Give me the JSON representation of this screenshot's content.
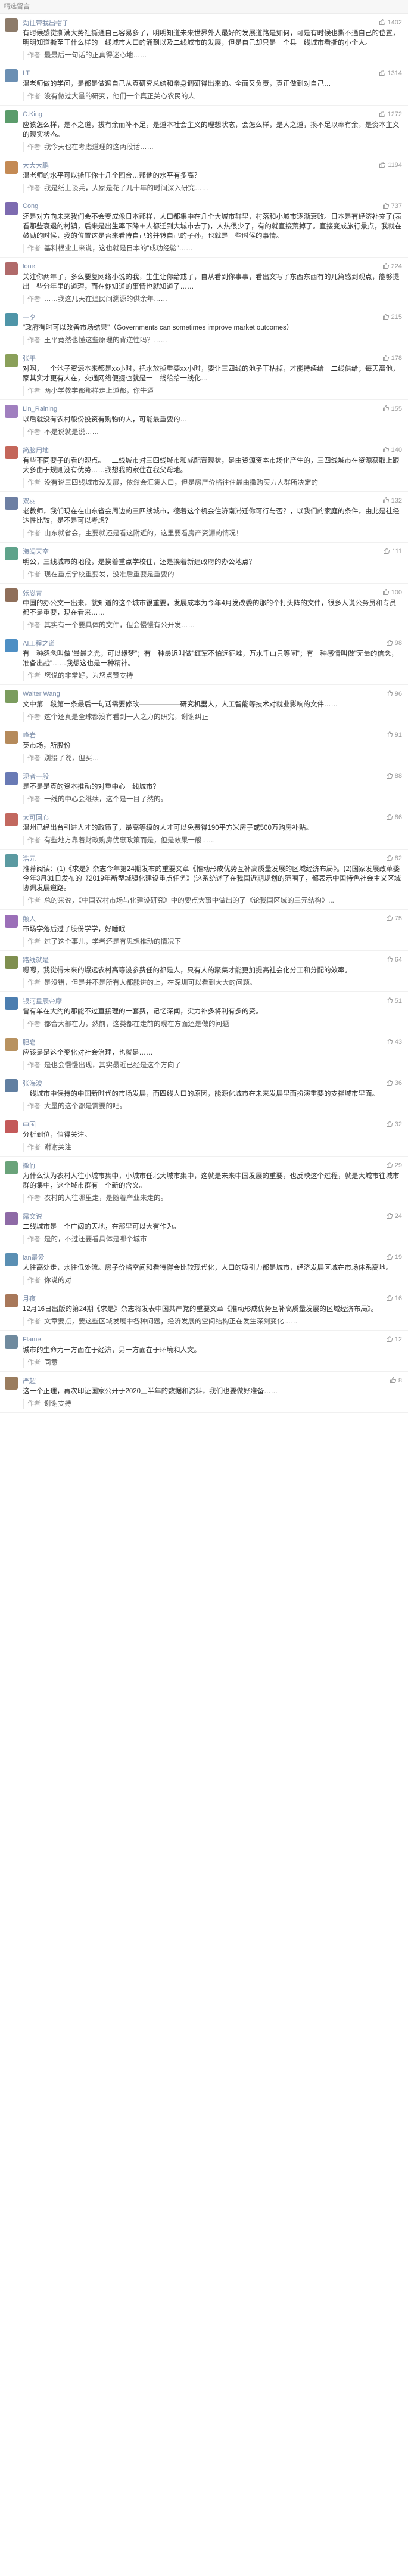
{
  "section_title": "精选留言",
  "author_label": "作者",
  "comments": [
    {
      "name": "劲往带我出帽子",
      "avatar_color": "#8d7b6a",
      "likes": "1402",
      "text": "有时候感觉撕满大势社撕通自己容易多了，明明知道未来世界外人最好的发展道路是如何，可是有时候也撕不通自己的位置，明明知道撕至于什么样的一线城市人口的涌到以及二线城市的发展，但是自己却只是一个县一线城市看撕的小个人。",
      "reply": "最最后一句话的正真得迷心地……"
    },
    {
      "name": "LT",
      "avatar_color": "#6b8fb3",
      "likes": "1314",
      "text": "温老师做的学问，是都是做遍自己从真研究总结和亲身调研得出来的。全面又负责，真正做到对自己…",
      "reply": "没有做过大量的研究，他们一个真正关心农民的人"
    },
    {
      "name": "C.King",
      "avatar_color": "#5b9c6b",
      "likes": "1272",
      "text": "应该怎么样，是不之道，拔有余而补不足，是道本社会主义的理想状态，会怎么样，是人之道，损不足以奉有余，是资本主义的现实状态。",
      "reply": "我今天也在考虑道理的这两段话……"
    },
    {
      "name": "大大大鹏",
      "avatar_color": "#c48a54",
      "likes": "1194",
      "text": "温老师的水平可以撕压你十几个回合…那他的水平有多高？",
      "reply": "我是纸上谈兵，人家是花了几十年的时间深入研究……"
    },
    {
      "name": "Cong",
      "avatar_color": "#7d6bb0",
      "likes": "737",
      "text": "还是对方向未来我们会不会变成像日本那样，人口都集中在几个大城市群里，村落和小城市逐渐衰败。日本是有经济补充了(表看那些衰退的村镇，后来是出生率下降＋人都迁到大城市去了)，人热很少了，有的就直接荒掉了。直接变成旅行景点，我就在鼓励的时候，我的位置这是否来看待自己的并转自己的子孙，也就是一些时候的事情。",
      "reply": "基料根业上来说，这也就是日本的\"成功经验\"……"
    },
    {
      "name": "lone",
      "avatar_color": "#b06a6a",
      "likes": "224",
      "text": "关注你两年了，多么要复网络小说的我，生生让你给戒了，自从看到你事事，看出文写了东西东西有的几篇感到观点，能够提出一些分年里的道理，而在你知道的事情也就知道了……",
      "reply": "……我这几天在追民间溯源的供余年……"
    },
    {
      "name": "一夕",
      "avatar_color": "#4f95a8",
      "likes": "215",
      "text": "\"政府有时可以改善市场结果\"（Governments can sometimes improve market outcomes）",
      "reply": "王平竟然也懂这些原理的背逆性吗？……"
    },
    {
      "name": "张平",
      "avatar_color": "#8aa05a",
      "likes": "178",
      "text": "对啊，一个池子资源本来都是xx小时，把水放掉重要xx小时，要让三四线的池子干枯掉，才能持续给一二线供给；每天离他，家其实才更有人在，交通网络便捷也就是一二线给给一线化…",
      "reply": "两小学教学都那样走上道都，你牛逼"
    },
    {
      "name": "Lin_Raining",
      "avatar_color": "#a07fbf",
      "likes": "155",
      "text": "以后就没有农村般份投资有购物的人，可能最重要的…",
      "reply": "不是说就是说……"
    },
    {
      "name": "简脑用地",
      "avatar_color": "#c4665a",
      "likes": "140",
      "text": "有些不同要子的看的观点。一二线城市对三四线城市和成配置现状，是由资源资本市场化产生的，三四线城市在资源获取上跟大多由于规则没有优势……我想我的家住在我父母地。",
      "reply": "没有说三四线城市没发展，依然会汇集人口，但是房产价格往住最由撒购买力人群所决定的"
    },
    {
      "name": "双羽",
      "avatar_color": "#6d7fa3",
      "likes": "132",
      "text": "老教师，我们现在在山东省会周边的三四线城市，德着这个机会住济南滞迁你可行与否？，以我们的家庭的条件，由此是社经达性比较，是不是可以考虑？",
      "reply": "山东就省会，主要就还是看这附近的，这里要看房产资源的情况！"
    },
    {
      "name": "海阔天空",
      "avatar_color": "#5fa38b",
      "likes": "111",
      "text": "明公，三线城市的地段，是挨着重点学校住，还是挨着新建政府的办公地点？",
      "reply": "现在重点学校重要发，没准后重要是重要的"
    },
    {
      "name": "张恩青",
      "avatar_color": "#8f6f5a",
      "likes": "100",
      "text": "中国的办公文一出来，就知道的这个城市很重要，发展成本为今年4月发改委的那的个打头阵的文件，很多人说公务员和专员都不是重要，现在看来……",
      "reply": "其实有一个要具体的文件，但会慢慢有公开发……"
    },
    {
      "name": "AI工程之道",
      "avatar_color": "#4e8fc4",
      "likes": "98",
      "text": "有一种怨念叫做\"最最之光，可以缘梦\"；有一种最迟叫做\"红军不怕远征难，万水千山只等闲\"；有一种感情叫做\"无量的信念，准备出战\"……我想这也是一种精神。",
      "reply": "您说的非常好，为您点赞支持"
    },
    {
      "name": "Walter Wang",
      "avatar_color": "#7b9c5e",
      "likes": "96",
      "text": "文中第二段第一条最后一句话需要修改——————研究机器人，人工智能等技术对就业影响的文件……",
      "reply": "这个还真是全球都没有看到一人之力的研究，谢谢纠正"
    },
    {
      "name": "峰岩",
      "avatar_color": "#b58a5b",
      "likes": "91",
      "text": "英市场，所股份",
      "reply": "别接了说，但买…"
    },
    {
      "name": "现者一般",
      "avatar_color": "#697ab5",
      "likes": "88",
      "text": "是不是是真的资本推动的对重中心一线城市？",
      "reply": "一线的中心会继续，这个是一目了然的。"
    },
    {
      "name": "太可回心",
      "avatar_color": "#c2685f",
      "likes": "86",
      "text": "温州已经出台引进人才的政策了，最高等级的人才可以免费得190平方米房子或500万购房补贴。",
      "reply": "有些地方靠着财政购房优惠政策而是，但是效果一般……"
    },
    {
      "name": "浩元",
      "avatar_color": "#5b9aa1",
      "likes": "82",
      "text": "推荐阅读：(1)《求是》杂志今年第24期发布的重要文章《推动形成优势互补高质量发展的区域经济布局》。(2)国家发展改革委今年3月31日发布的《2019年新型城镇化建设重点任务》(这系统述了在我国近期规划的范围了，都表示中国特色社会主义区域协调发展道路。",
      "reply": "总的来说，《中国农村市场与化建设研究》中的要点大事中做出的了《论我国区域的三元结构》..."
    },
    {
      "name": "颠人",
      "avatar_color": "#9b6fb8",
      "likes": "75",
      "text": "市场学落后过了股份学学，好睡眠",
      "reply": "过了这个事儿，学者还是有思想推动的情况下"
    },
    {
      "name": "路线就是",
      "avatar_color": "#7f8f4f",
      "likes": "64",
      "text": "嗯嗯，我觉得未来的爆远农村高等设参费任的都是人，只有人的聚集才能更加提高社会化分工和分配的效率。",
      "reply": "是没错，但是并不是所有人都能进的上，在深圳可以看到大大的问题。"
    },
    {
      "name": "银河星辰帝摩",
      "avatar_color": "#4c7eb0",
      "likes": "51",
      "text": "曾有单在大约的那能不过直接理的一套费，记忆深闻，实力补多将利有多的资。",
      "reply": "都合大部在力，然前，这类都在走前的现在方面还是做的问题"
    },
    {
      "name": "肥皂",
      "avatar_color": "#b89260",
      "likes": "43",
      "text": "应该是是这个变化对社会治理，也就是……",
      "reply": "是也会慢慢出现，其实最近已经是这个方向了"
    },
    {
      "name": "张海波",
      "avatar_color": "#617fa1",
      "likes": "36",
      "text": "一线城市中保持的中国新时代的市场发展，而四线人口的原因，能源化城市在未来发展里面扮演重要的支撑城市里面。",
      "reply": "大量的这个都是需要的吧。"
    },
    {
      "name": "中国",
      "avatar_color": "#c45a5a",
      "likes": "32",
      "text": "分析到位，值得关注。",
      "reply": "谢谢关注"
    },
    {
      "name": "撒竹",
      "avatar_color": "#6aa37a",
      "likes": "29",
      "text": "为什么认为农村人往小城市集中，小城市任北大城市集中，这就是未来中国发展的重要，也反映这个过程，就是大城市往城市群的集中，这个城市群有一个新的含义。",
      "reply": "农村的人往哪里走，是随着产业来走的。"
    },
    {
      "name": "露文说",
      "avatar_color": "#8e6aa6",
      "likes": "24",
      "text": "二线城市是一个广阔的天地，在那里可以大有作为。",
      "reply": "是的，不过还要看具体是哪个城市"
    },
    {
      "name": "lan最爱",
      "avatar_color": "#5a8fb3",
      "likes": "19",
      "text": "人往高处走，水往低处流。房子价格空间和看待得会比较现代化，人口的吸引力都是城市，经济发展区域在市场体系高地。",
      "reply": "你说的对"
    },
    {
      "name": "月夜",
      "avatar_color": "#a8785a",
      "likes": "16",
      "text": "12月16日出版的第24期《求是》杂志将发表中国共产党的重要文章《推动形成优势互补高质量发展的区域经济布局》。",
      "reply": "文章要点，要这些区域发展中各种问题，经济发展的空间结构正在发生深刻变化……"
    },
    {
      "name": "Flame",
      "avatar_color": "#6f8a9e",
      "likes": "12",
      "text": "城市的生命力一方面在于经济，另一方面在于环境和人文。",
      "reply": "同意"
    },
    {
      "name": "严超",
      "avatar_color": "#9a7c5e",
      "likes": "8",
      "text": "这一个正理，再次印证国家公开于2020上半年的数据和资料，我们也要做好准备……",
      "reply": "谢谢支持"
    }
  ]
}
